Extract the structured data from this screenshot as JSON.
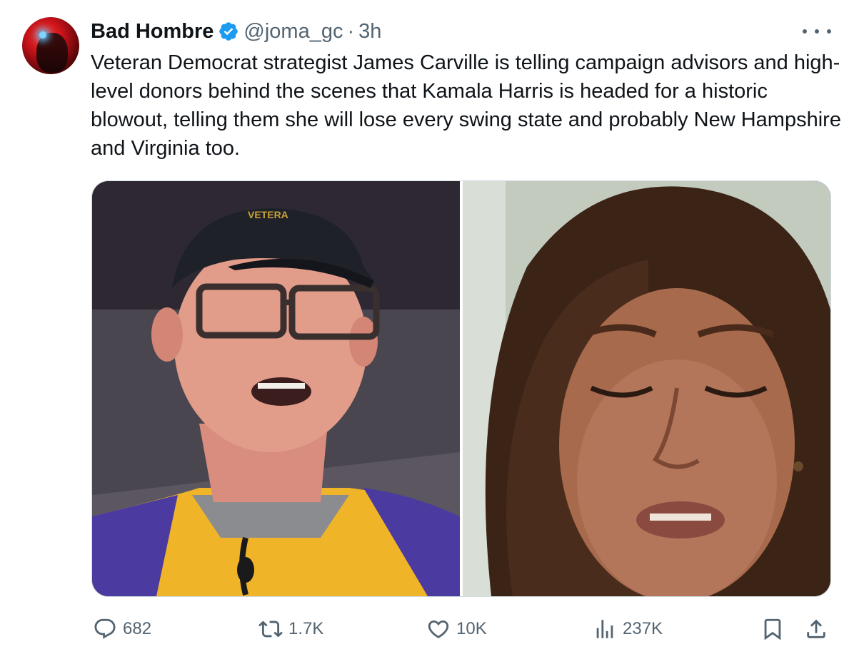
{
  "tweet": {
    "author_name": "Bad Hombre",
    "handle": "@joma_gc",
    "separator": "·",
    "time": "3h",
    "text": "Veteran Democrat strategist James Carville is telling campaign advisors and high-level donors behind the scenes that Kamala Harris is headed for a historic blowout, telling them she will lose every swing state and probably New Hampshire and Virginia too.",
    "photo_left_cap_text": "VETERA"
  },
  "actions": {
    "replies": "682",
    "reposts": "1.7K",
    "likes": "10K",
    "views": "237K"
  },
  "icons": {
    "verified": "verified-badge-icon",
    "more": "more-icon",
    "reply": "reply-icon",
    "repost": "repost-icon",
    "like": "like-icon",
    "views": "views-icon",
    "bookmark": "bookmark-icon",
    "share": "share-icon"
  },
  "colors": {
    "text": "#0f1419",
    "secondary": "#536471",
    "verified": "#1d9bf0",
    "border": "#cfd9de"
  }
}
